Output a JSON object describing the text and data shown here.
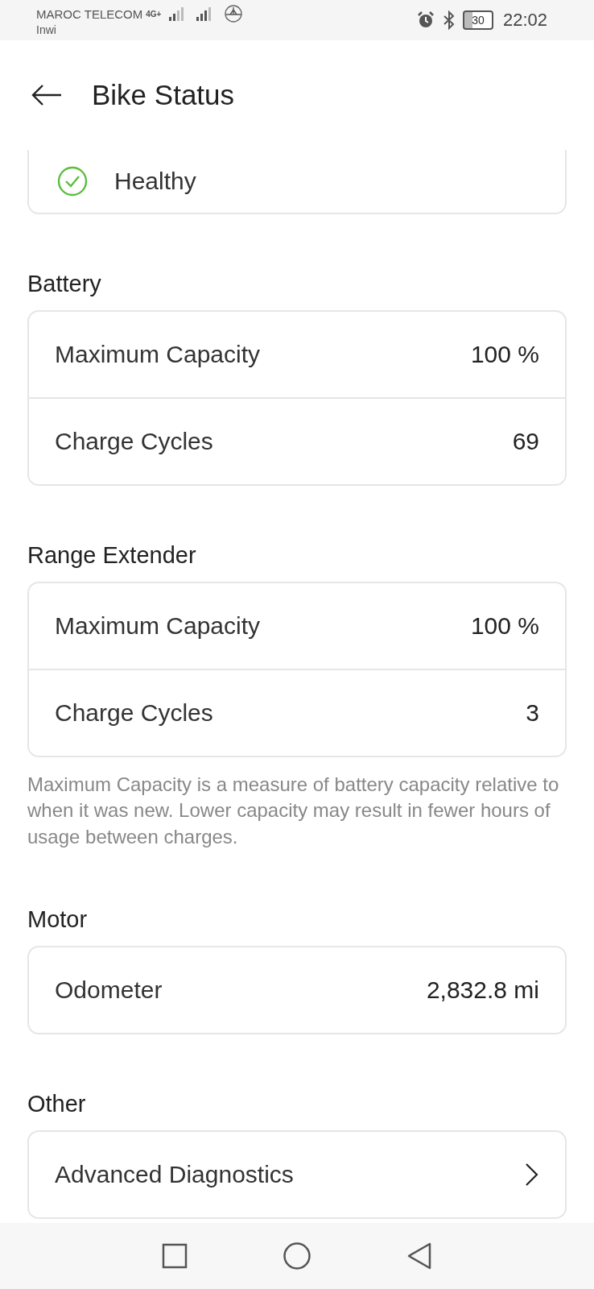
{
  "status_bar": {
    "carrier_1": "MAROC TELECOM",
    "network": "4G+",
    "carrier_2": "Inwi",
    "battery": "30",
    "time": "22:02"
  },
  "header": {
    "title": "Bike Status"
  },
  "health": {
    "label": "Healthy"
  },
  "sections": [
    {
      "title": "Battery",
      "rows": [
        {
          "kind": "value",
          "label": "Maximum Capacity",
          "value": "100 %"
        },
        {
          "kind": "value",
          "label": "Charge Cycles",
          "value": "69"
        }
      ]
    },
    {
      "title": "Range Extender",
      "rows": [
        {
          "kind": "value",
          "label": "Maximum Capacity",
          "value": "100 %"
        },
        {
          "kind": "value",
          "label": "Charge Cycles",
          "value": "3"
        }
      ],
      "note": "Maximum Capacity is a measure of battery capacity relative to when it was new. Lower capacity may result in fewer hours of usage between charges."
    },
    {
      "title": "Motor",
      "rows": [
        {
          "kind": "value",
          "label": "Odometer",
          "value": "2,832.8 mi"
        }
      ]
    },
    {
      "title": "Other",
      "rows": [
        {
          "kind": "link",
          "label": "Advanced Diagnostics"
        }
      ]
    }
  ]
}
